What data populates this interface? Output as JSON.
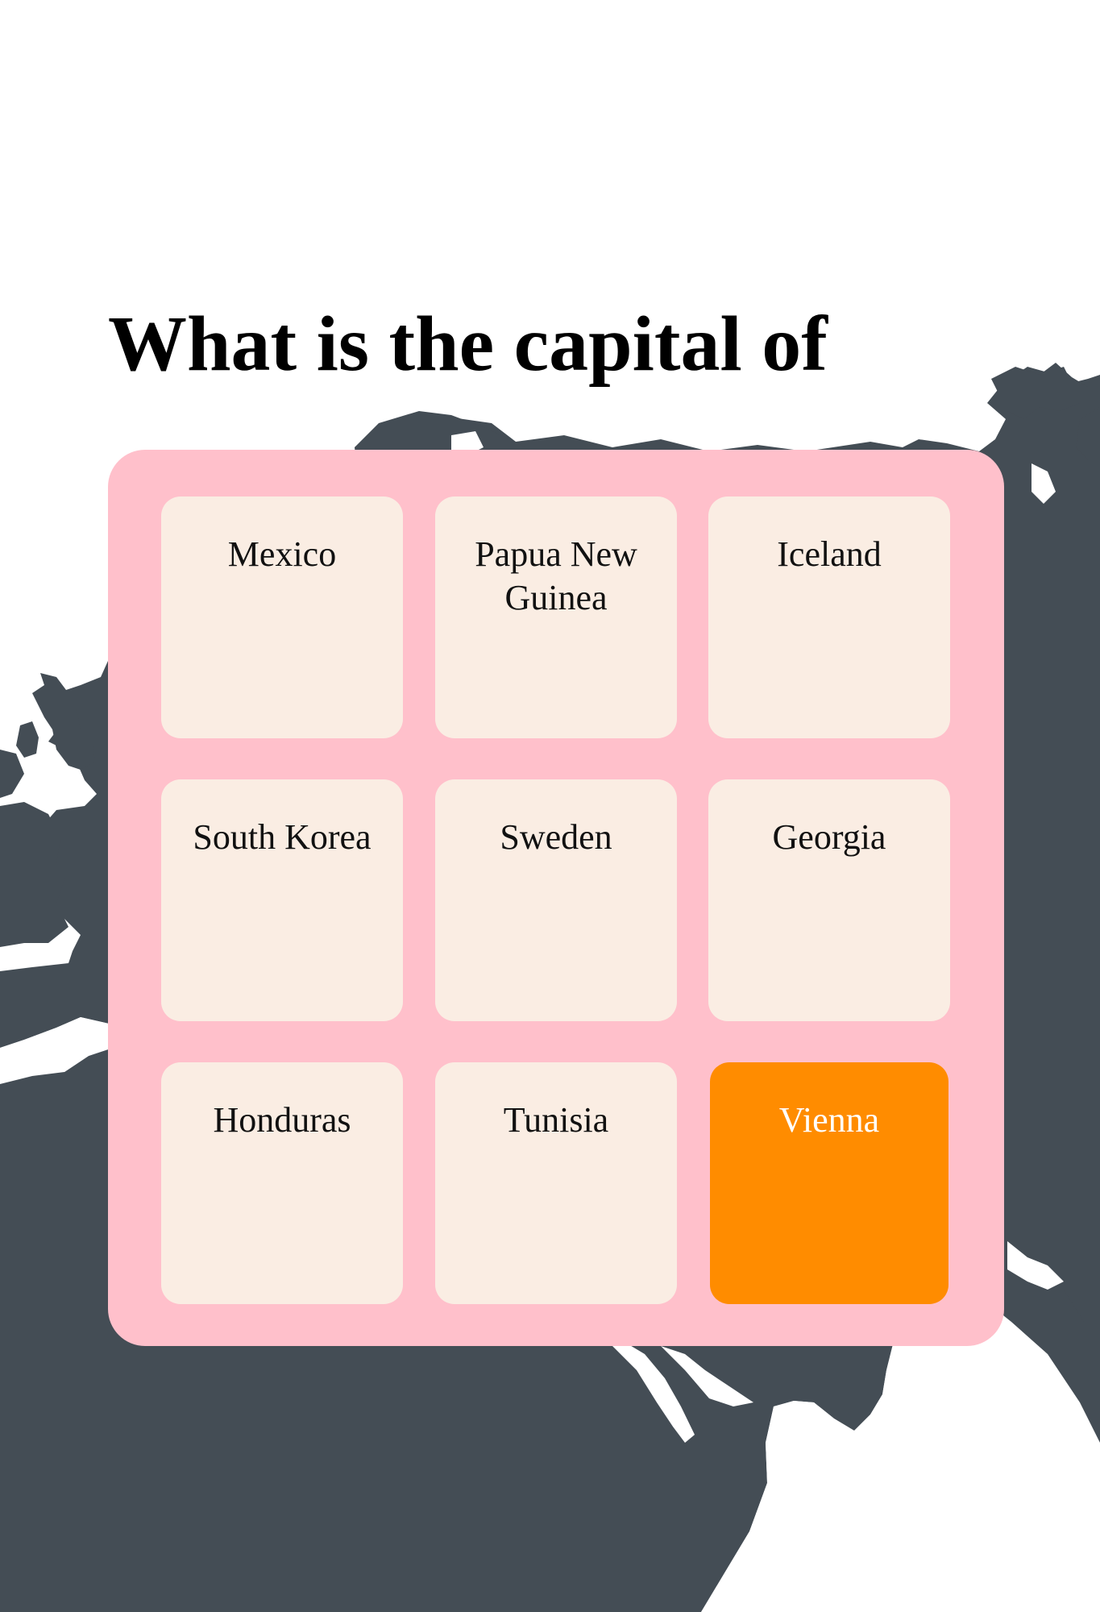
{
  "question": "What is the capital of",
  "tiles": [
    {
      "label": "Mexico",
      "selected": false
    },
    {
      "label": "Papua New Guinea",
      "selected": false
    },
    {
      "label": "Iceland",
      "selected": false
    },
    {
      "label": "South Korea",
      "selected": false
    },
    {
      "label": "Sweden",
      "selected": false
    },
    {
      "label": "Georgia",
      "selected": false
    },
    {
      "label": "Honduras",
      "selected": false
    },
    {
      "label": "Tunisia",
      "selected": false
    },
    {
      "label": "Vienna",
      "selected": true
    }
  ],
  "colors": {
    "board": "#ffc0cb",
    "tile": "#faede3",
    "selected_tile": "#ff8c00",
    "map": "#444d55"
  }
}
